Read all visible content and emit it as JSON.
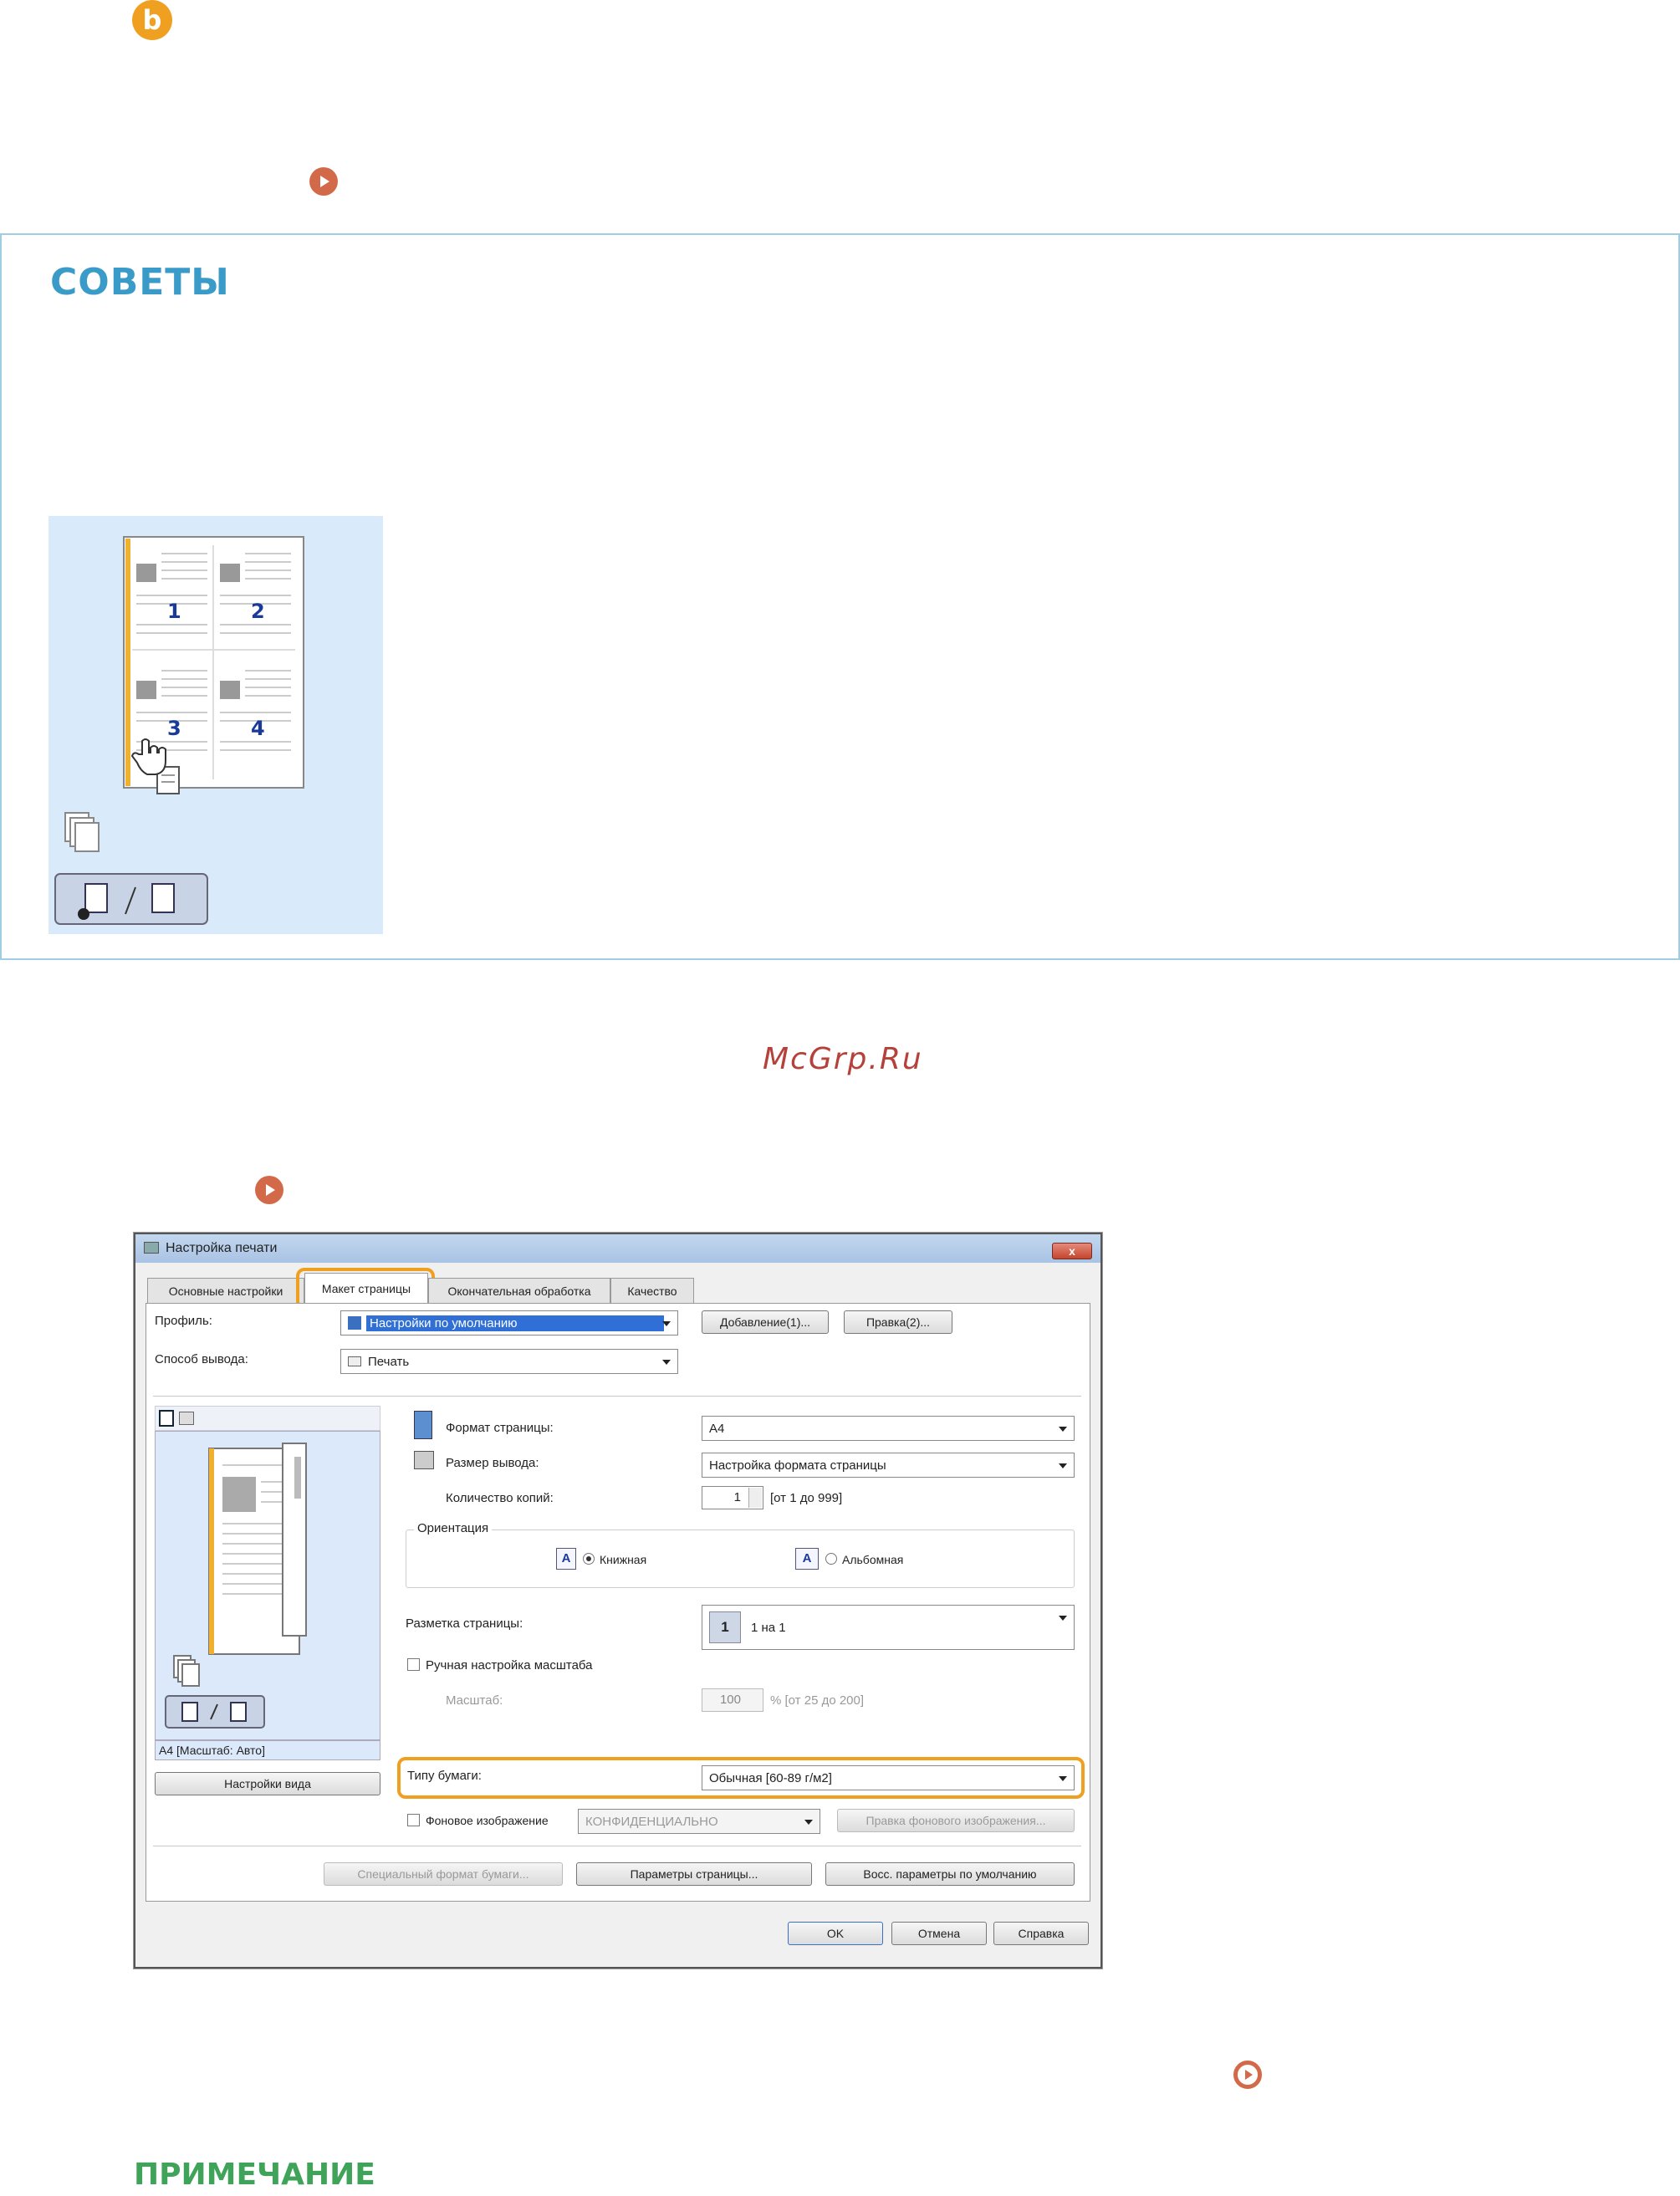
{
  "step": {
    "badge": "b"
  },
  "tips": {
    "title": "СОВЕТЫ",
    "illustration": {
      "page_numbers": [
        "1",
        "2",
        "3",
        "4"
      ]
    }
  },
  "watermark": "McGrp.Ru",
  "note": {
    "title": "ПРИМЕЧАНИЕ"
  },
  "dialog": {
    "title": "Настройка печати",
    "close_label": "x",
    "tabs": [
      "Основные настройки",
      "Макет страницы",
      "Окончательная обработка",
      "Качество"
    ],
    "profile_label": "Профиль:",
    "profile_value": "Настройки по умолчанию",
    "add_button": "Добавление(1)...",
    "edit_button": "Правка(2)...",
    "output_label": "Способ вывода:",
    "output_value": "Печать",
    "page_size_label": "Формат страницы:",
    "page_size_value": "A4",
    "output_size_label": "Размер вывода:",
    "output_size_value": "Настройка формата страницы",
    "copies_label": "Количество копий:",
    "copies_value": "1",
    "copies_range": "[от 1 до 999]",
    "orientation_label": "Ориентация",
    "portrait_label": "Книжная",
    "landscape_label": "Альбомная",
    "orientation_icon_letter": "A",
    "layout_label": "Разметка страницы:",
    "layout_icon_number": "1",
    "layout_value": "1 на 1",
    "manual_scale_label": "Ручная настройка масштаба",
    "scale_label": "Масштаб:",
    "scale_value": "100",
    "scale_range": "% [от 25 до 200]",
    "preview_caption": "A4 [Масштаб: Авто]",
    "view_settings_button": "Настройки вида",
    "paper_type_label": "Типу бумаги:",
    "paper_type_value": "Обычная [60-89 г/м2]",
    "watermark_label": "Фоновое изображение",
    "watermark_value": "КОНФИДЕНЦИАЛЬНО",
    "watermark_edit_button": "Правка фонового изображения...",
    "custom_paper_button": "Специальный формат бумаги...",
    "page_options_button": "Параметры страницы...",
    "restore_defaults_button": "Восс. параметры по умолчанию",
    "ok_button": "OK",
    "cancel_button": "Отмена",
    "help_button": "Справка"
  },
  "colors": {
    "accent_orange": "#f0a020",
    "tips_blue": "#3a9bc8",
    "link_red": "#d26a4a",
    "note_green": "#3fa35a",
    "watermark_red": "#b5413a"
  }
}
